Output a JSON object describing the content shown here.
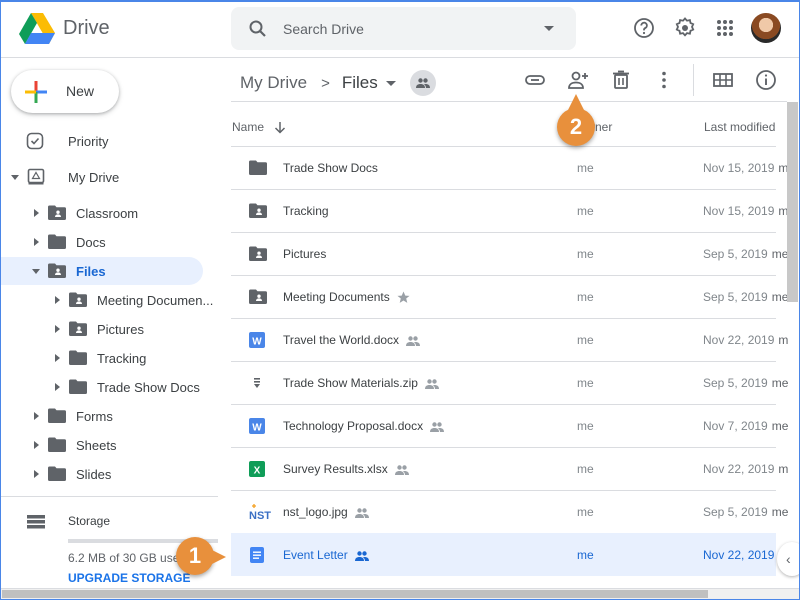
{
  "header": {
    "app_title": "Drive",
    "search_placeholder": "Search Drive",
    "icons": [
      "help-icon",
      "settings-icon",
      "apps-grid-icon",
      "account-avatar"
    ]
  },
  "sidebar": {
    "new_label": "New",
    "priority_label": "Priority",
    "my_drive_label": "My Drive",
    "tree": [
      {
        "label": "Classroom",
        "level": 1,
        "expanded": false,
        "shared": true
      },
      {
        "label": "Docs",
        "level": 1,
        "expanded": false,
        "shared": false
      },
      {
        "label": "Files",
        "level": 1,
        "expanded": true,
        "shared": true,
        "active": true
      },
      {
        "label": "Meeting Documen...",
        "level": 2,
        "expanded": false,
        "shared": true
      },
      {
        "label": "Pictures",
        "level": 2,
        "expanded": false,
        "shared": true
      },
      {
        "label": "Tracking",
        "level": 2,
        "expanded": false,
        "shared": false
      },
      {
        "label": "Trade Show Docs",
        "level": 2,
        "expanded": false,
        "shared": false
      },
      {
        "label": "Forms",
        "level": 1,
        "expanded": false,
        "shared": false
      },
      {
        "label": "Sheets",
        "level": 1,
        "expanded": false,
        "shared": false
      },
      {
        "label": "Slides",
        "level": 1,
        "expanded": false,
        "shared": false
      }
    ],
    "storage_label": "Storage",
    "storage_used": "6.2 MB of 30 GB used",
    "storage_fraction": 0.0002,
    "upgrade_label": "UPGRADE STORAGE"
  },
  "breadcrumb": {
    "root": "My Drive",
    "separator": ">",
    "current": "Files"
  },
  "toolbar": [
    "get-link-icon",
    "share-add-person-icon",
    "trash-icon",
    "more-vert-icon",
    "grid-view-icon",
    "info-icon"
  ],
  "columns": {
    "name": "Name",
    "owner": "Owner",
    "modified": "Last modified"
  },
  "files": [
    {
      "name": "Trade Show Docs",
      "type": "folder",
      "owner": "me",
      "modified": "Nov 15, 2019",
      "modified_by": "m",
      "badge": ""
    },
    {
      "name": "Tracking",
      "type": "shared-folder",
      "owner": "me",
      "modified": "Nov 15, 2019",
      "modified_by": "m",
      "badge": ""
    },
    {
      "name": "Pictures",
      "type": "shared-folder",
      "owner": "me",
      "modified": "Sep 5, 2019",
      "modified_by": "me",
      "badge": ""
    },
    {
      "name": "Meeting Documents",
      "type": "shared-folder",
      "owner": "me",
      "modified": "Sep 5, 2019",
      "modified_by": "me",
      "badge": "star"
    },
    {
      "name": "Travel the World.docx",
      "type": "word",
      "owner": "me",
      "modified": "Nov 22, 2019",
      "modified_by": "m",
      "badge": "shared"
    },
    {
      "name": "Trade Show Materials.zip",
      "type": "zip",
      "owner": "me",
      "modified": "Sep 5, 2019",
      "modified_by": "me",
      "badge": "shared"
    },
    {
      "name": "Technology Proposal.docx",
      "type": "word",
      "owner": "me",
      "modified": "Nov 7, 2019",
      "modified_by": "me",
      "badge": "shared"
    },
    {
      "name": "Survey Results.xlsx",
      "type": "excel",
      "owner": "me",
      "modified": "Nov 22, 2019",
      "modified_by": "m",
      "badge": "shared"
    },
    {
      "name": "nst_logo.jpg",
      "type": "image",
      "owner": "me",
      "modified": "Sep 5, 2019",
      "modified_by": "me",
      "badge": "shared"
    },
    {
      "name": "Event Letter",
      "type": "gdoc",
      "owner": "me",
      "modified": "Nov 22, 2019",
      "modified_by": "",
      "badge": "shared",
      "selected": true
    }
  ],
  "callouts": [
    {
      "number": "1",
      "target": "Event Letter row"
    },
    {
      "number": "2",
      "target": "Share button"
    }
  ],
  "colors": {
    "accent": "#1a73e8",
    "selected_bg": "#e8f0fe",
    "callout": "#e8903c"
  }
}
